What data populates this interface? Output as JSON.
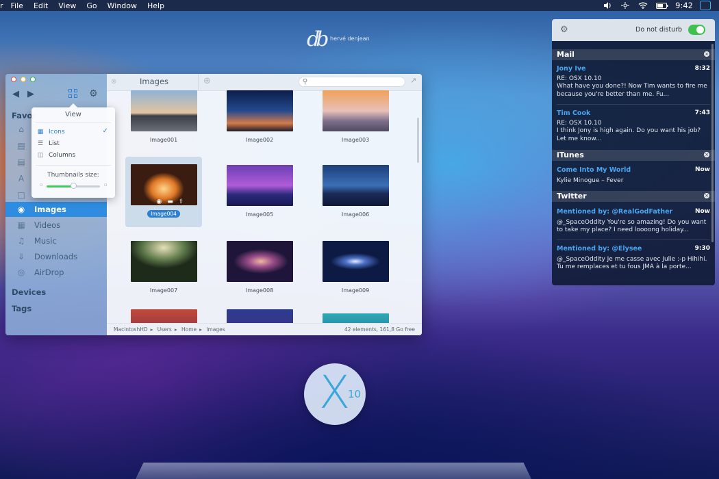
{
  "menubar": {
    "apple_glyph": "r",
    "menus": [
      "File",
      "Edit",
      "View",
      "Go",
      "Window",
      "Help"
    ],
    "clock": "9:42"
  },
  "wallpaper_logo": {
    "mark": "db",
    "name": "hervé denjean"
  },
  "finder": {
    "sidebar": {
      "favorites_label": "Favor",
      "items": [
        {
          "label": "Images",
          "icon": "camera-icon",
          "active": true
        },
        {
          "label": "Videos",
          "icon": "film-icon"
        },
        {
          "label": "Music",
          "icon": "music-icon"
        },
        {
          "label": "Downloads",
          "icon": "download-icon"
        },
        {
          "label": "AirDrop",
          "icon": "airdrop-icon"
        }
      ],
      "devices_label": "Devices",
      "tags_label": "Tags"
    },
    "tab": {
      "title": "Images"
    },
    "thumbnails": [
      "Image001",
      "Image002",
      "Image003",
      "Image004",
      "Image005",
      "Image006",
      "Image007",
      "Image008",
      "Image009"
    ],
    "selected": "Image004",
    "breadcrumb": [
      "MacintoshHD",
      "Users",
      "Home",
      "Images"
    ],
    "status": "42 elements, 161,8 Go free"
  },
  "view_popover": {
    "title": "View",
    "options": [
      "Icons",
      "List",
      "Columns"
    ],
    "selected": "Icons",
    "slider_label": "Thumbnails size:",
    "slider_value": 0.5
  },
  "notification_center": {
    "dnd_label": "Do not disturb",
    "dnd_on": true,
    "sections": [
      {
        "title": "Mail",
        "notes": [
          {
            "from": "Jony Ive",
            "time": "8:32",
            "subject": "RE: OSX 10.10",
            "body": "What have you done?! Now Tim wants to fire me because you're better than me. Fu..."
          },
          {
            "from": "Tim Cook",
            "time": "7:43",
            "subject": "RE: OSX 10.10",
            "body": "I think Jony is high again. Do you want his job? Let me know..."
          }
        ]
      },
      {
        "title": "iTunes",
        "notes": [
          {
            "from": "Come Into My World",
            "time": "Now",
            "body": "Kylie Minogue – Fever"
          }
        ]
      },
      {
        "title": "Twitter",
        "notes": [
          {
            "from": "Mentioned by: @RealGodFather",
            "time": "Now",
            "body": "@_SpaceOddity You're so amazing! Do you want to take my place? I need loooong holiday..."
          },
          {
            "from": "Mentioned by: @Elysee",
            "time": "9:30",
            "body": "@_SpaceOddity Je me casse avec Julie :-p Hihihi. Tu me remplaces et tu fous JMA à la porte..."
          }
        ]
      }
    ]
  },
  "os_logo": {
    "x": "X",
    "ten": "10"
  },
  "colors": {
    "accent": "#2e8de0",
    "toggle_on": "#3ec14f",
    "link": "#4aa6f0"
  }
}
